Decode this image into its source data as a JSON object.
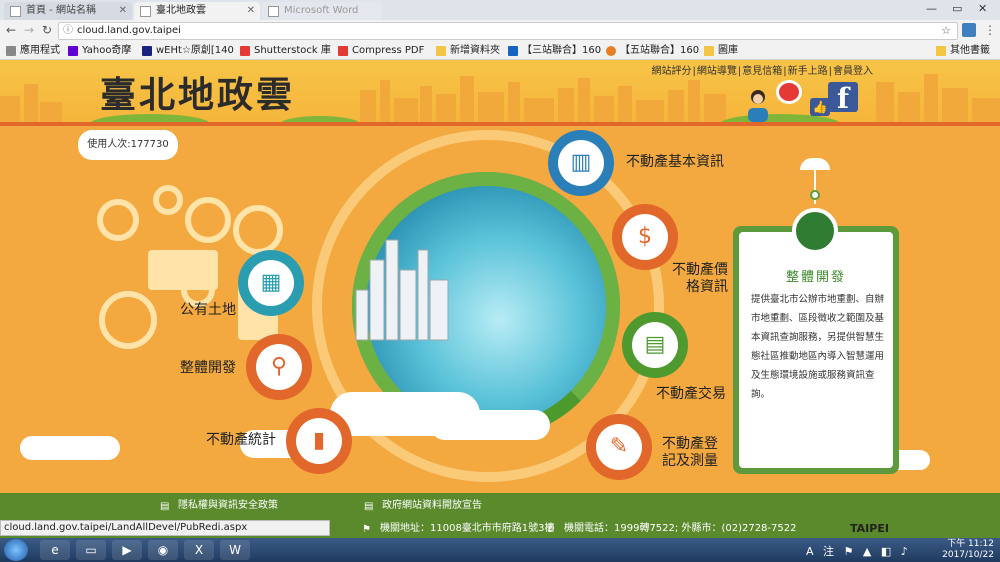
{
  "browser": {
    "tabs": [
      {
        "title": "首頁 - 網站名稱",
        "active": false
      },
      {
        "title": "臺北地政雲",
        "active": true
      },
      {
        "title": "Microsoft Word",
        "active": false
      }
    ],
    "url": "cloud.land.gov.taipei",
    "window_controls": [
      "—",
      "▭",
      "✕"
    ],
    "bookmarks": [
      {
        "label": "應用程式",
        "color": "#888888"
      },
      {
        "label": "Yahoo奇摩",
        "color": "#5f01d1"
      },
      {
        "label": "wEHt☆原創[140",
        "color": "#1a237e"
      },
      {
        "label": "Shutterstock 庫",
        "color": "#e53935"
      },
      {
        "label": "Compress PDF",
        "color": "#e53935"
      },
      {
        "label": "新增資料夾",
        "color": "#f4c542"
      },
      {
        "label": "【三站聯合】160",
        "color": "#1565c0"
      },
      {
        "label": "【五站聯合】160",
        "color": "#e67e22"
      },
      {
        "label": "圖庫",
        "color": "#f4c542"
      },
      {
        "label": "其他書籤",
        "color": "#f4c542"
      }
    ],
    "status_url": "cloud.land.gov.taipei/LandAllDevel/PubRedi.aspx"
  },
  "site": {
    "logo": "臺北地政雲",
    "top_links": [
      "網站評分",
      "網站導覽",
      "意見信箱",
      "新手上路",
      "會員登入"
    ],
    "counter": "使用人次:177730",
    "menu": [
      {
        "label": "不動產基本資訊",
        "icon": "building-icon",
        "ring": "#2a7fb8",
        "glyph": "▥"
      },
      {
        "label": "不動產價格資訊",
        "icon": "price-icon",
        "ring": "#e2672a",
        "glyph": "$"
      },
      {
        "label": "不動產交易",
        "icon": "transaction-icon",
        "ring": "#4e9a2e",
        "glyph": "▤"
      },
      {
        "label": "不動產登記及測量",
        "icon": "register-icon",
        "ring": "#e2672a",
        "glyph": "✎"
      },
      {
        "label": "公有土地",
        "icon": "map-icon",
        "ring": "#2a9db0",
        "glyph": "▦"
      },
      {
        "label": "整體開發",
        "icon": "search-people-icon",
        "ring": "#e2672a",
        "glyph": "⚲"
      },
      {
        "label": "不動產統計",
        "icon": "chart-icon",
        "ring": "#e2672a",
        "glyph": "▮"
      }
    ],
    "panel": {
      "title": "整體開發",
      "text": "提供臺北市公辦市地重劃、自辦市地重劃、區段徵收之範圍及基本資訊查詢服務，另提供智慧生態社區推動地區內導入智慧運用及生態環境設施或服務資訊查詢。"
    },
    "footer": {
      "privacy": "隱私權與資訊安全政策",
      "open_data": "政府網站資料開放宣告",
      "address": "機關地址：11008臺北市市府路1號3樓",
      "phone": "機關電話：1999轉7522; 外縣市：(02)2728-7522"
    },
    "brand": "TAIPEI"
  },
  "taskbar": {
    "time": "下午 11:12",
    "date": "2017/10/22",
    "apps": [
      "ie-icon",
      "explorer-icon",
      "media-icon",
      "chrome-icon",
      "excel-icon",
      "word-icon"
    ],
    "ime": "A 注"
  },
  "colors": {
    "page_bg": "#f3a93f",
    "header_stripe": "#e2672a",
    "footer_green": "#5a8a2c",
    "panel_green": "#5d9a3b"
  }
}
